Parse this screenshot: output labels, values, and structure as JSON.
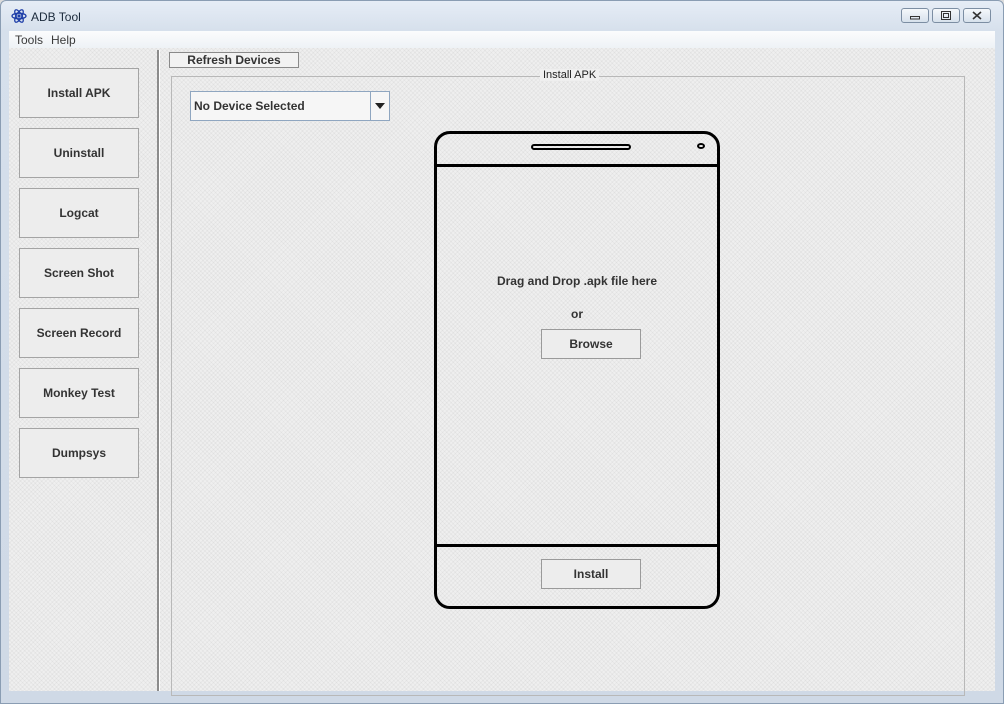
{
  "window": {
    "title": "ADB Tool",
    "icon": "atom-icon",
    "controls": [
      "minimize-icon",
      "restore-icon",
      "close-icon"
    ]
  },
  "menu": {
    "items": [
      {
        "label": "Tools"
      },
      {
        "label": "Help"
      }
    ]
  },
  "sidebar": {
    "items": [
      {
        "label": "Install APK"
      },
      {
        "label": "Uninstall"
      },
      {
        "label": "Logcat"
      },
      {
        "label": "Screen Shot"
      },
      {
        "label": "Screen Record"
      },
      {
        "label": "Monkey Test"
      },
      {
        "label": "Dumpsys"
      }
    ]
  },
  "toolbar": {
    "refresh_label": "Refresh Devices"
  },
  "install_panel": {
    "title": "Install APK",
    "device_select": {
      "value": "No Device Selected"
    },
    "drop_text": "Drag and Drop .apk file here",
    "or_text": "or",
    "browse_label": "Browse",
    "install_label": "Install"
  },
  "colors": {
    "accent": "#8fa6c0",
    "icon_blue": "#1f3fa8"
  }
}
